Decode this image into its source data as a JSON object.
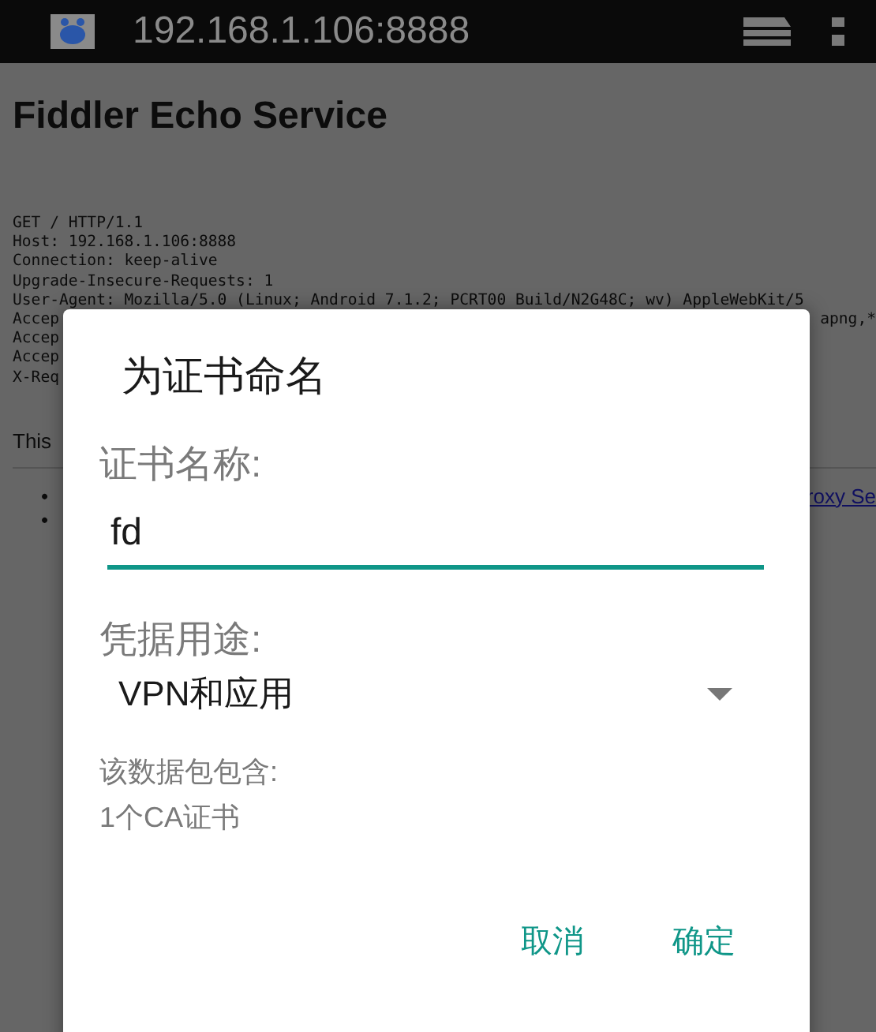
{
  "toolbar": {
    "url": "192.168.1.106:8888"
  },
  "page": {
    "heading": "Fiddler Echo Service",
    "request_lines": [
      {
        "left": "GET / HTTP/1.1"
      },
      {
        "left": "Host: 192.168.1.106:8888"
      },
      {
        "left": "Connection: keep-alive"
      },
      {
        "left": "Upgrade-Insecure-Requests: 1"
      },
      {
        "left": "User-Agent: Mozilla/5.0 (Linux; Android 7.1.2; PCRT00 Build/N2G48C; wv) AppleWebKit/5"
      },
      {
        "left": "Accep",
        "right": "apng,*"
      },
      {
        "left": "Accep"
      },
      {
        "left": "Accep"
      },
      {
        "left": "X-Req"
      }
    ],
    "note": "This",
    "bullets": [
      {
        "marker": "•",
        "link": "roxy Se"
      },
      {
        "marker": "•"
      }
    ]
  },
  "dialog": {
    "title": "为证书命名",
    "name_label": "证书名称:",
    "name_value": "fd",
    "name_focused": true,
    "usage_label": "凭据用途:",
    "usage_value": "VPN和应用",
    "contents_label": "该数据包包含:",
    "contents_value": "1个CA证书",
    "buttons": [
      "取消",
      "确定"
    ]
  }
}
